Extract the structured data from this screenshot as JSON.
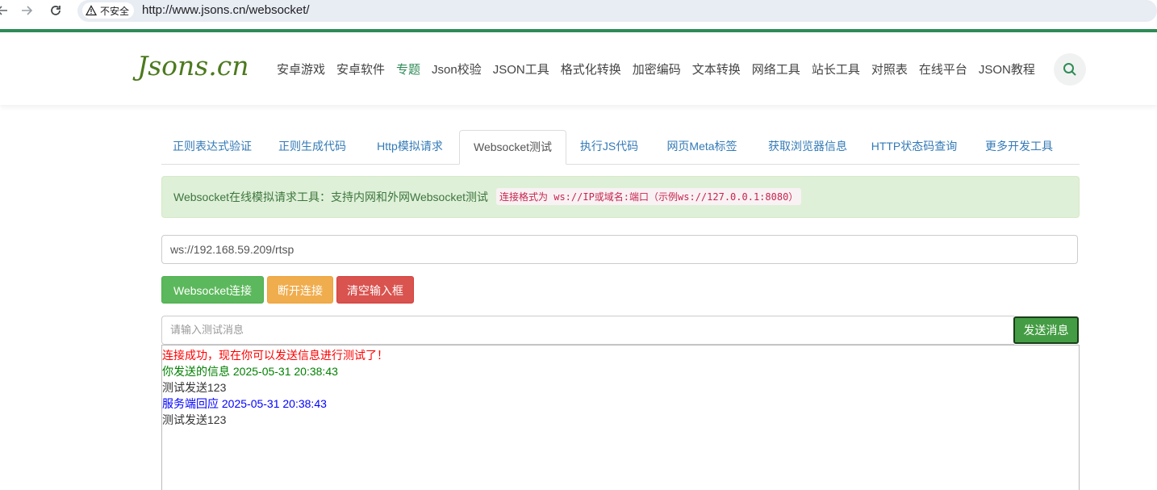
{
  "browser": {
    "back_icon": "arrow-left-icon",
    "forward_icon": "arrow-right-icon",
    "reload_icon": "reload-icon",
    "security_label": "不安全",
    "url": "http://www.jsons.cn/websocket/"
  },
  "header": {
    "logo_text": "Jsons.cn",
    "nav": [
      "安卓游戏",
      "安卓软件",
      "专题",
      "Json校验",
      "JSON工具",
      "格式化转换",
      "加密编码",
      "文本转换",
      "网络工具",
      "站长工具",
      "对照表",
      "在线平台",
      "JSON教程"
    ],
    "active_nav": "专题"
  },
  "tabs": [
    {
      "label": "正则表达式验证"
    },
    {
      "label": "正则生成代码"
    },
    {
      "label": "Http模拟请求"
    },
    {
      "label": "Websocket测试"
    },
    {
      "label": "执行JS代码"
    },
    {
      "label": "网页Meta标签"
    },
    {
      "label": "获取浏览器信息"
    },
    {
      "label": "HTTP状态码查询"
    },
    {
      "label": "更多开发工具"
    }
  ],
  "active_tab": "Websocket测试",
  "alert": {
    "text": "Websocket在线模拟请求工具：支持内网和外网Websocket测试",
    "code": "连接格式为 ws://IP或域名:端口（示例ws://127.0.0.1:8080）"
  },
  "ws_url": "ws://192.168.59.209/rtsp",
  "buttons": {
    "connect": "Websocket连接",
    "disconnect": "断开连接",
    "clear": "清空输入框",
    "send": "发送消息"
  },
  "message_input": {
    "placeholder": "请输入测试消息",
    "value": ""
  },
  "log": [
    {
      "text": "连接成功，现在你可以发送信息进行测试了！",
      "color": "#ff0000"
    },
    {
      "text": "你发送的信息 2025-05-31 20:38:43",
      "color": "#008000"
    },
    {
      "text": "测试发送123",
      "color": "#333333"
    },
    {
      "text": "服务端回应 2025-05-31 20:38:43",
      "color": "#0000ff"
    },
    {
      "text": "测试发送123",
      "color": "#333333"
    }
  ],
  "colors": {
    "brand": "#2e8b57",
    "link": "#337ab7"
  }
}
